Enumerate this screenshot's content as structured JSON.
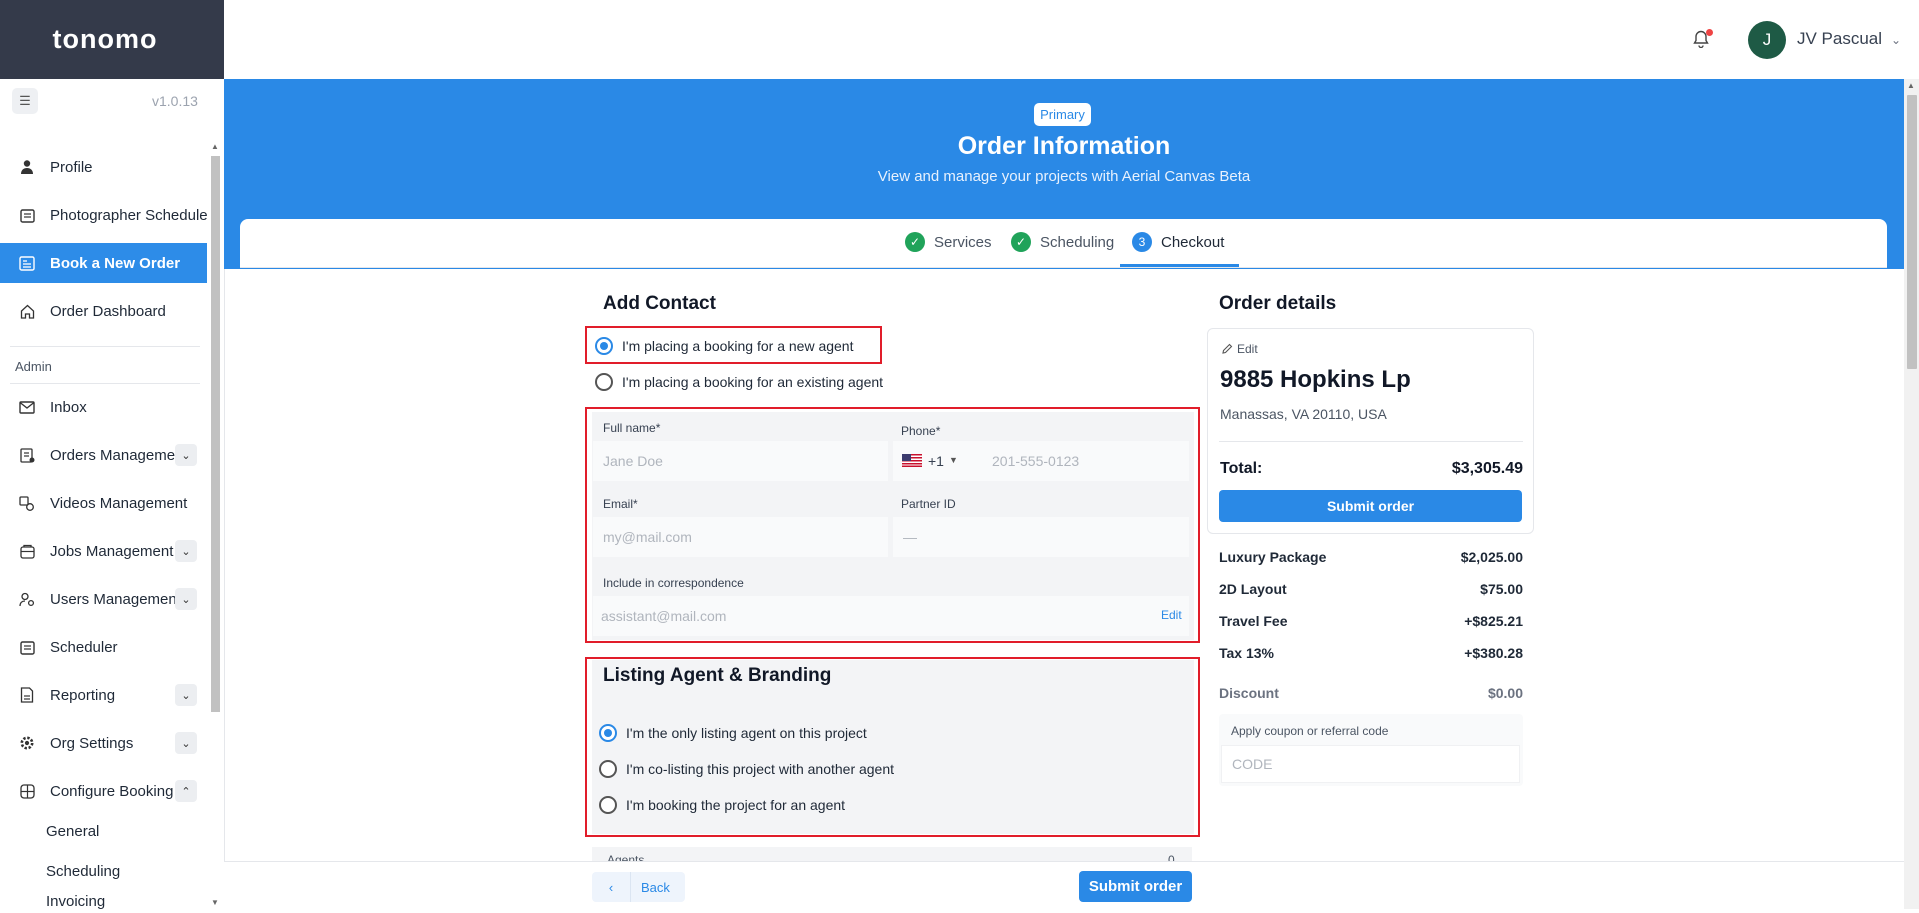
{
  "app": {
    "logo": "tonomo",
    "version": "v1.0.13"
  },
  "sidebar": {
    "collapse_icon": "collapse-sidebar-icon",
    "items": [
      {
        "label": "Profile",
        "icon": "user-icon"
      },
      {
        "label": "Photographer Schedule",
        "icon": "calendar-icon"
      },
      {
        "label": "Book a New Order",
        "icon": "book-icon",
        "active": true
      },
      {
        "label": "Order Dashboard",
        "icon": "home-icon"
      }
    ],
    "admin_label": "Admin",
    "admin_items": [
      {
        "label": "Inbox",
        "icon": "mail-icon"
      },
      {
        "label": "Orders Management",
        "icon": "orders-icon",
        "expand": "down"
      },
      {
        "label": "Videos Management",
        "icon": "video-icon"
      },
      {
        "label": "Jobs Management",
        "icon": "jobs-icon",
        "expand": "down"
      },
      {
        "label": "Users Management",
        "icon": "users-icon",
        "expand": "down"
      },
      {
        "label": "Scheduler",
        "icon": "scheduler-icon"
      },
      {
        "label": "Reporting",
        "icon": "report-icon",
        "expand": "down"
      },
      {
        "label": "Org Settings",
        "icon": "gear-icon",
        "expand": "down"
      },
      {
        "label": "Configure Booking",
        "icon": "configure-icon",
        "expand": "up"
      }
    ],
    "sub_items": [
      "General",
      "Scheduling",
      "Invoicing"
    ]
  },
  "topbar": {
    "user_name": "JV Pascual",
    "avatar_letter": "J"
  },
  "hero": {
    "badge": "Primary",
    "title": "Order Information",
    "subtitle": "View and manage your projects with Aerial Canvas Beta"
  },
  "steps": [
    {
      "label": "Services",
      "state": "done"
    },
    {
      "label": "Scheduling",
      "state": "done"
    },
    {
      "label": "Checkout",
      "state": "current",
      "number": "3"
    }
  ],
  "contact": {
    "title": "Add Contact",
    "radio_new": "I'm placing a booking for a new agent",
    "radio_existing": "I'm placing a booking for an existing agent",
    "full_name_label": "Full name*",
    "full_name_placeholder": "Jane Doe",
    "phone_label": "Phone*",
    "phone_code": "+1",
    "phone_placeholder": "201-555-0123",
    "email_label": "Email*",
    "email_placeholder": "my@mail.com",
    "partner_label": "Partner ID",
    "partner_placeholder": "—",
    "correspondence_label": "Include in correspondence",
    "correspondence_placeholder": "assistant@mail.com",
    "edit_label": "Edit"
  },
  "branding": {
    "title": "Listing Agent & Branding",
    "options": [
      "I'm the only listing agent on this project",
      "I'm co-listing this project with another agent",
      "I'm booking the project for an agent"
    ],
    "agents_label": "Agents",
    "agents_count": "0"
  },
  "order": {
    "title": "Order details",
    "edit": "Edit",
    "address": "9885 Hopkins Lp",
    "city": "Manassas, VA 20110, USA",
    "total_label": "Total:",
    "total_value": "$3,305.49",
    "submit": "Submit order",
    "line_items": [
      {
        "name": "Luxury Package",
        "value": "$2,025.00"
      },
      {
        "name": "2D Layout",
        "value": "$75.00"
      },
      {
        "name": "Travel Fee",
        "value": "+$825.21"
      },
      {
        "name": "Tax 13%",
        "value": "+$380.28"
      }
    ],
    "discount_label": "Discount",
    "discount_value": "$0.00",
    "coupon_label": "Apply coupon or referral code",
    "coupon_placeholder": "CODE"
  },
  "footer": {
    "back": "Back",
    "submit": "Submit order"
  }
}
